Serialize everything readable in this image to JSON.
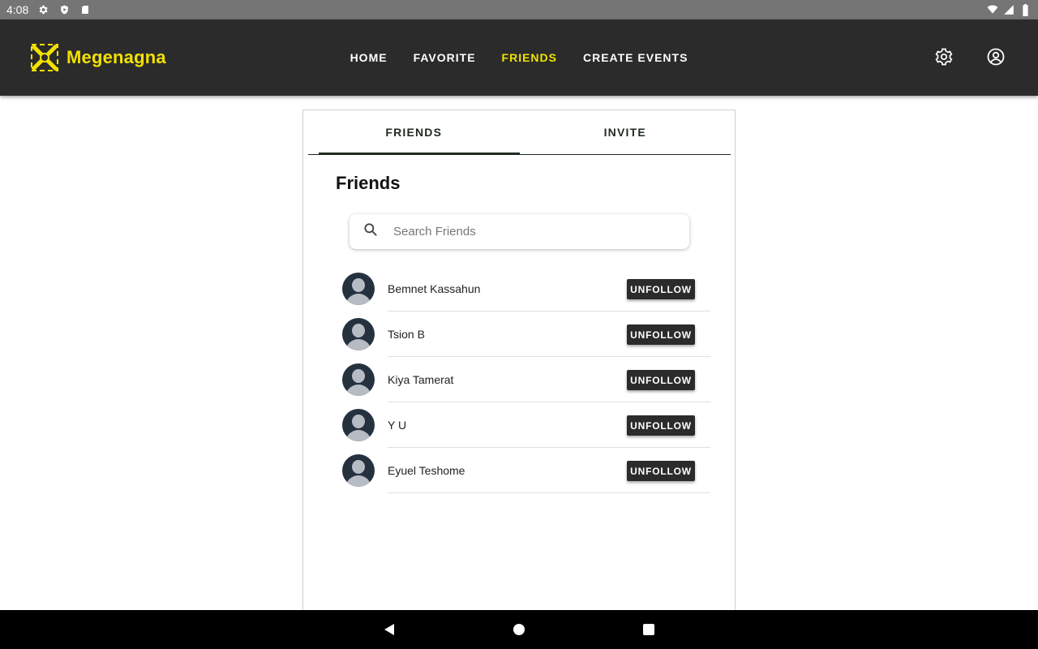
{
  "status_bar": {
    "time": "4:08",
    "left_icons": [
      "gear-icon",
      "shield-icon",
      "sd-card-icon"
    ],
    "right_icons": [
      "wifi-icon",
      "signal-icon",
      "battery-icon"
    ]
  },
  "app_bar": {
    "brand_name": "Megenagna",
    "nav": [
      {
        "label": "HOME",
        "active": false
      },
      {
        "label": "FAVORITE",
        "active": false
      },
      {
        "label": "FRIENDS",
        "active": true
      },
      {
        "label": "CREATE EVENTS",
        "active": false
      }
    ],
    "accent_color": "#f2e200",
    "background_color": "#2b2b2b"
  },
  "tabs": [
    {
      "label": "FRIENDS",
      "active": true
    },
    {
      "label": "INVITE",
      "active": false
    }
  ],
  "section": {
    "title": "Friends"
  },
  "search": {
    "placeholder": "Search Friends",
    "value": ""
  },
  "friends": [
    {
      "name": "Bemnet Kassahun",
      "action": "UNFOLLOW"
    },
    {
      "name": "Tsion B",
      "action": "UNFOLLOW"
    },
    {
      "name": "Kiya Tamerat",
      "action": "UNFOLLOW"
    },
    {
      "name": "Y U",
      "action": "UNFOLLOW"
    },
    {
      "name": "Eyuel Teshome",
      "action": "UNFOLLOW"
    }
  ],
  "system_nav": [
    "back-icon",
    "home-icon",
    "recents-icon"
  ]
}
